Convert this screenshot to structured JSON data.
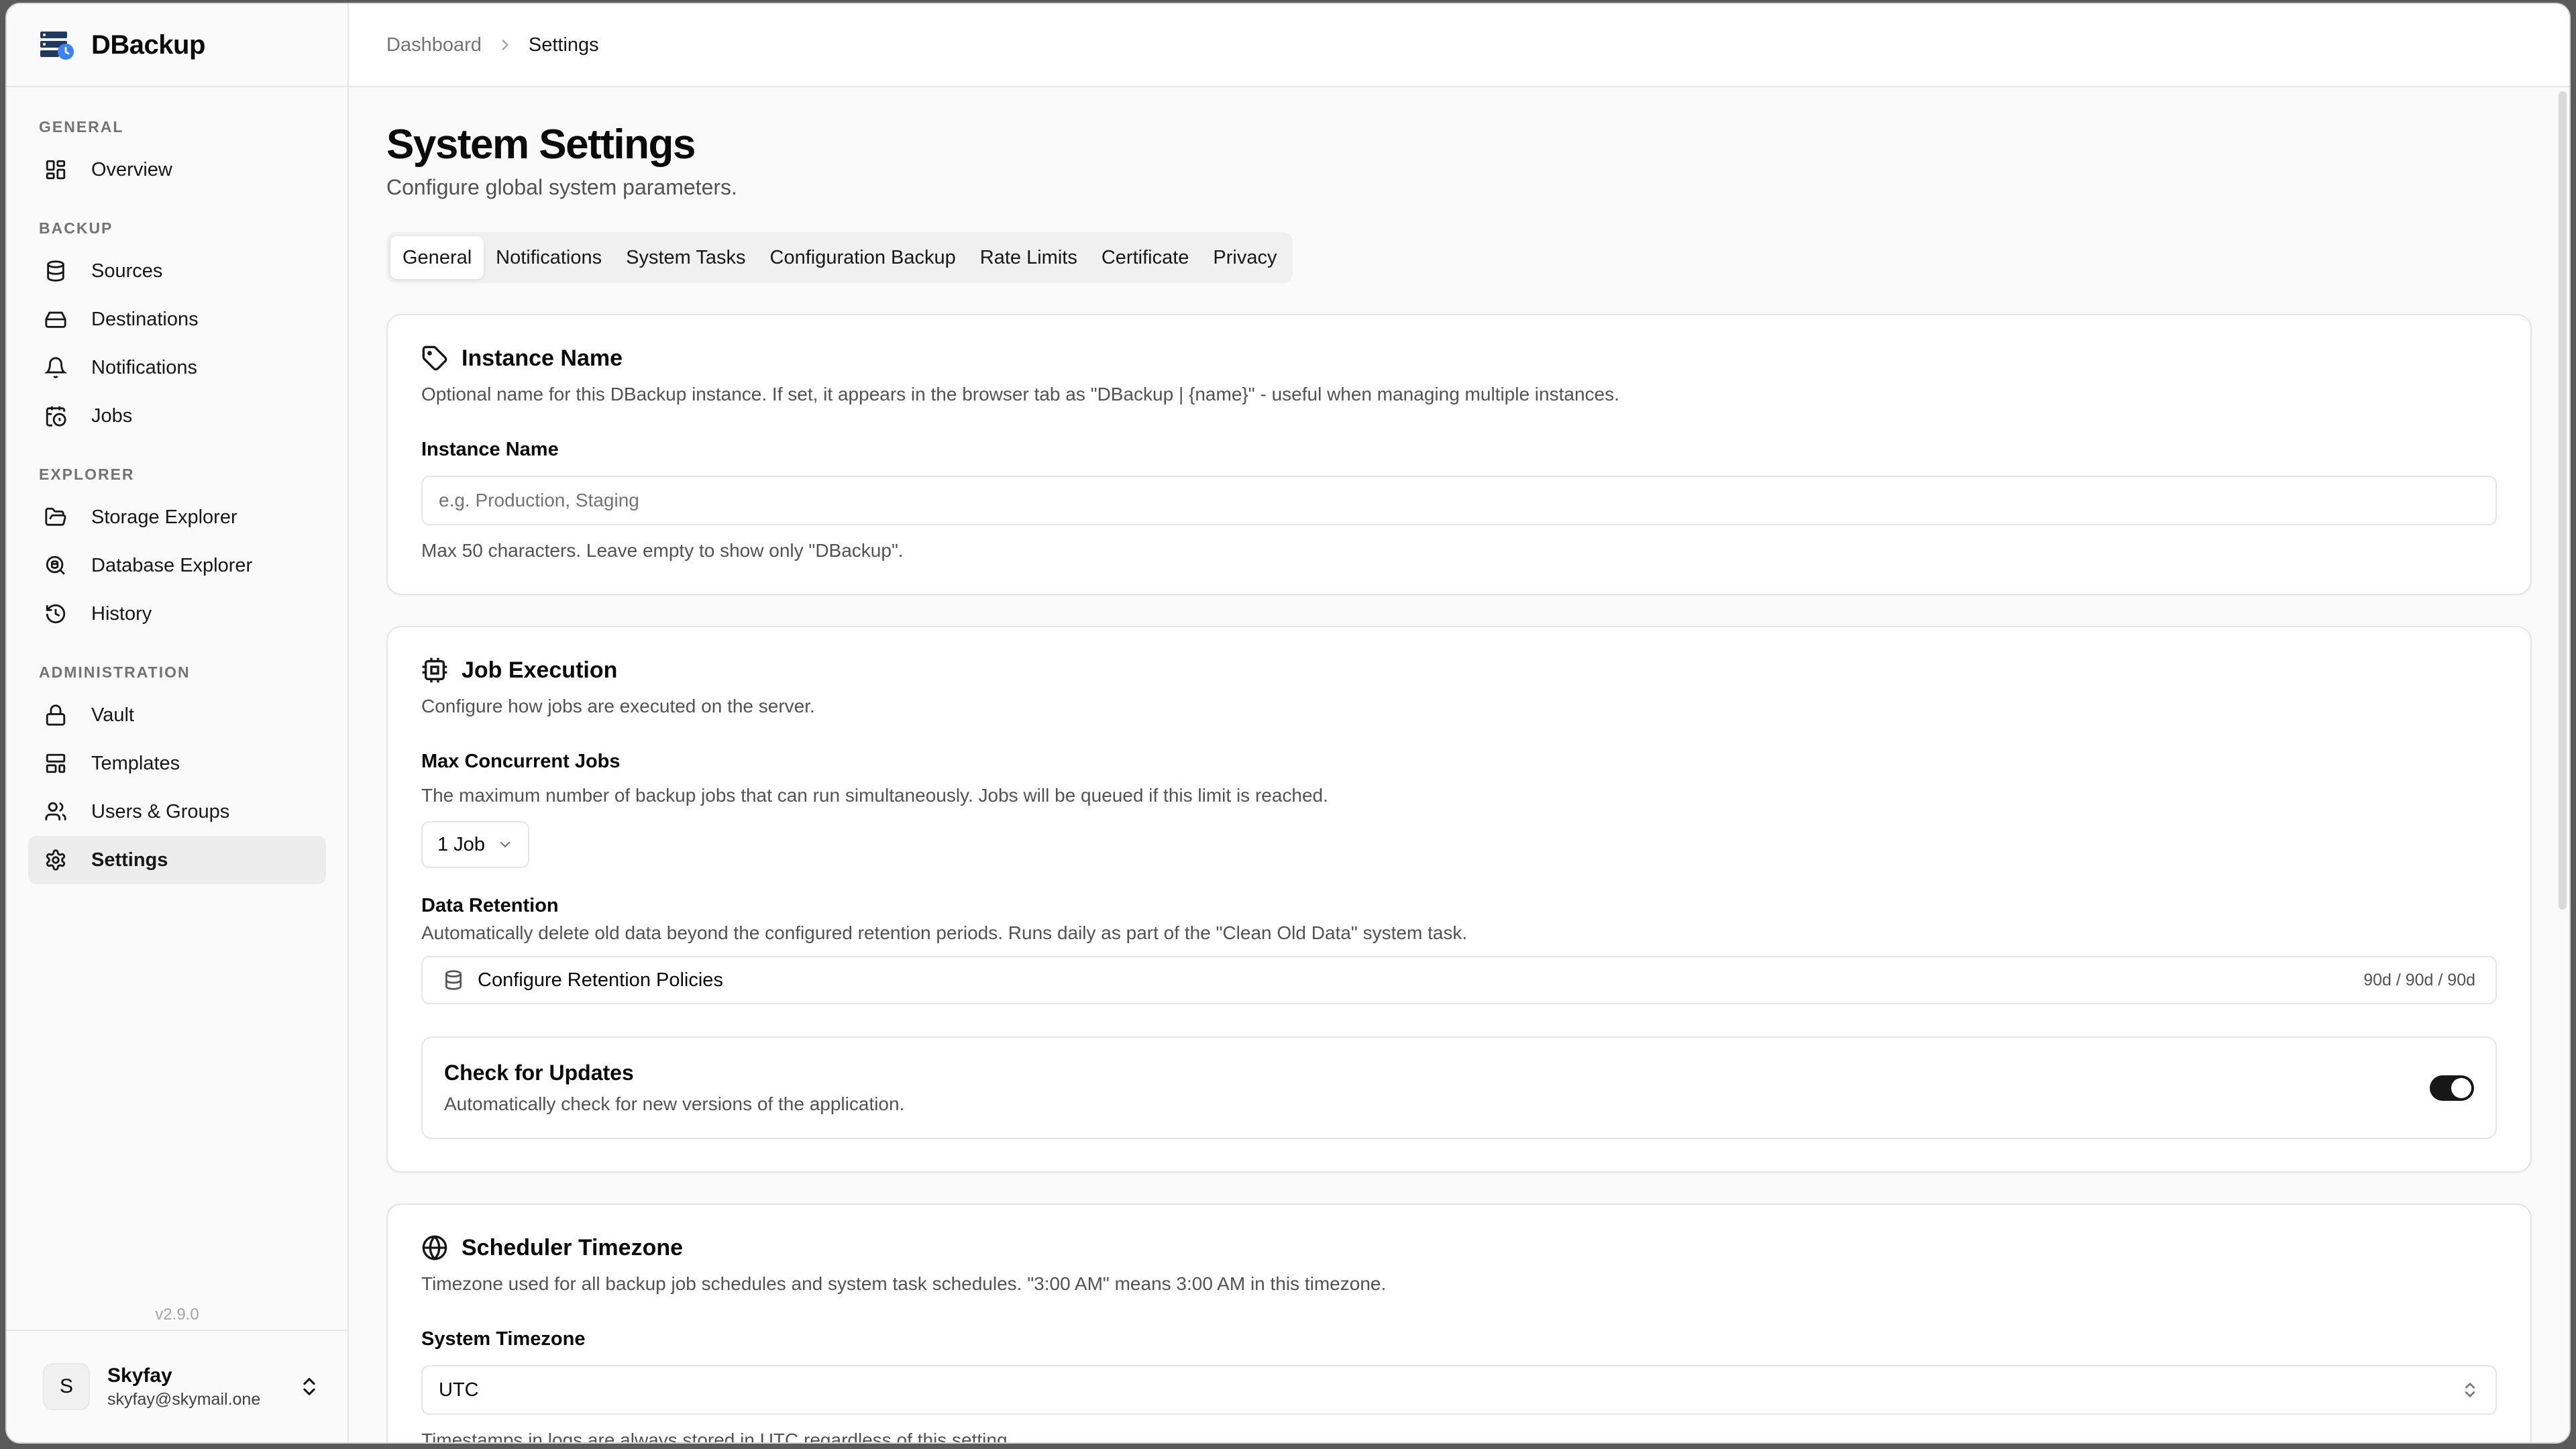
{
  "app": {
    "name": "DBackup",
    "version": "v2.9.0"
  },
  "sidebar": {
    "groups": [
      {
        "label": "GENERAL",
        "items": [
          {
            "label": "Overview",
            "icon": "grid-icon"
          }
        ]
      },
      {
        "label": "BACKUP",
        "items": [
          {
            "label": "Sources",
            "icon": "database-icon"
          },
          {
            "label": "Destinations",
            "icon": "hard-drive-icon"
          },
          {
            "label": "Notifications",
            "icon": "bell-icon"
          },
          {
            "label": "Jobs",
            "icon": "calendar-clock-icon"
          }
        ]
      },
      {
        "label": "EXPLORER",
        "items": [
          {
            "label": "Storage Explorer",
            "icon": "folder-open-icon"
          },
          {
            "label": "Database Explorer",
            "icon": "search-database-icon"
          },
          {
            "label": "History",
            "icon": "history-icon"
          }
        ]
      },
      {
        "label": "ADMINISTRATION",
        "items": [
          {
            "label": "Vault",
            "icon": "lock-icon"
          },
          {
            "label": "Templates",
            "icon": "layout-template-icon"
          },
          {
            "label": "Users & Groups",
            "icon": "users-icon"
          },
          {
            "label": "Settings",
            "icon": "gear-icon",
            "active": true
          }
        ]
      }
    ]
  },
  "user": {
    "initial": "S",
    "name": "Skyfay",
    "email": "skyfay@skymail.one"
  },
  "breadcrumb": {
    "parent": "Dashboard",
    "current": "Settings"
  },
  "page": {
    "title": "System Settings",
    "subtitle": "Configure global system parameters."
  },
  "tabs": [
    "General",
    "Notifications",
    "System Tasks",
    "Configuration Backup",
    "Rate Limits",
    "Certificate",
    "Privacy"
  ],
  "active_tab": "General",
  "instance": {
    "title": "Instance Name",
    "desc": "Optional name for this DBackup instance. If set, it appears in the browser tab as \"DBackup | {name}\" - useful when managing multiple instances.",
    "label": "Instance Name",
    "placeholder": "e.g. Production, Staging",
    "hint": "Max 50 characters. Leave empty to show only \"DBackup\"."
  },
  "job_execution": {
    "title": "Job Execution",
    "desc": "Configure how jobs are executed on the server.",
    "max_label": "Max Concurrent Jobs",
    "max_desc": "The maximum number of backup jobs that can run simultaneously. Jobs will be queued if this limit is reached.",
    "max_value": "1 Job",
    "retention_label": "Data Retention",
    "retention_desc": "Automatically delete old data beyond the configured retention periods. Runs daily as part of the \"Clean Old Data\" system task.",
    "retention_button": "Configure Retention Policies",
    "retention_meta": "90d / 90d / 90d",
    "updates_title": "Check for Updates",
    "updates_desc": "Automatically check for new versions of the application.",
    "updates_enabled": true
  },
  "timezone": {
    "title": "Scheduler Timezone",
    "desc": "Timezone used for all backup job schedules and system task schedules. \"3:00 AM\" means 3:00 AM in this timezone.",
    "label": "System Timezone",
    "value": "UTC",
    "hint": "Timestamps in logs are always stored in UTC regardless of this setting."
  }
}
